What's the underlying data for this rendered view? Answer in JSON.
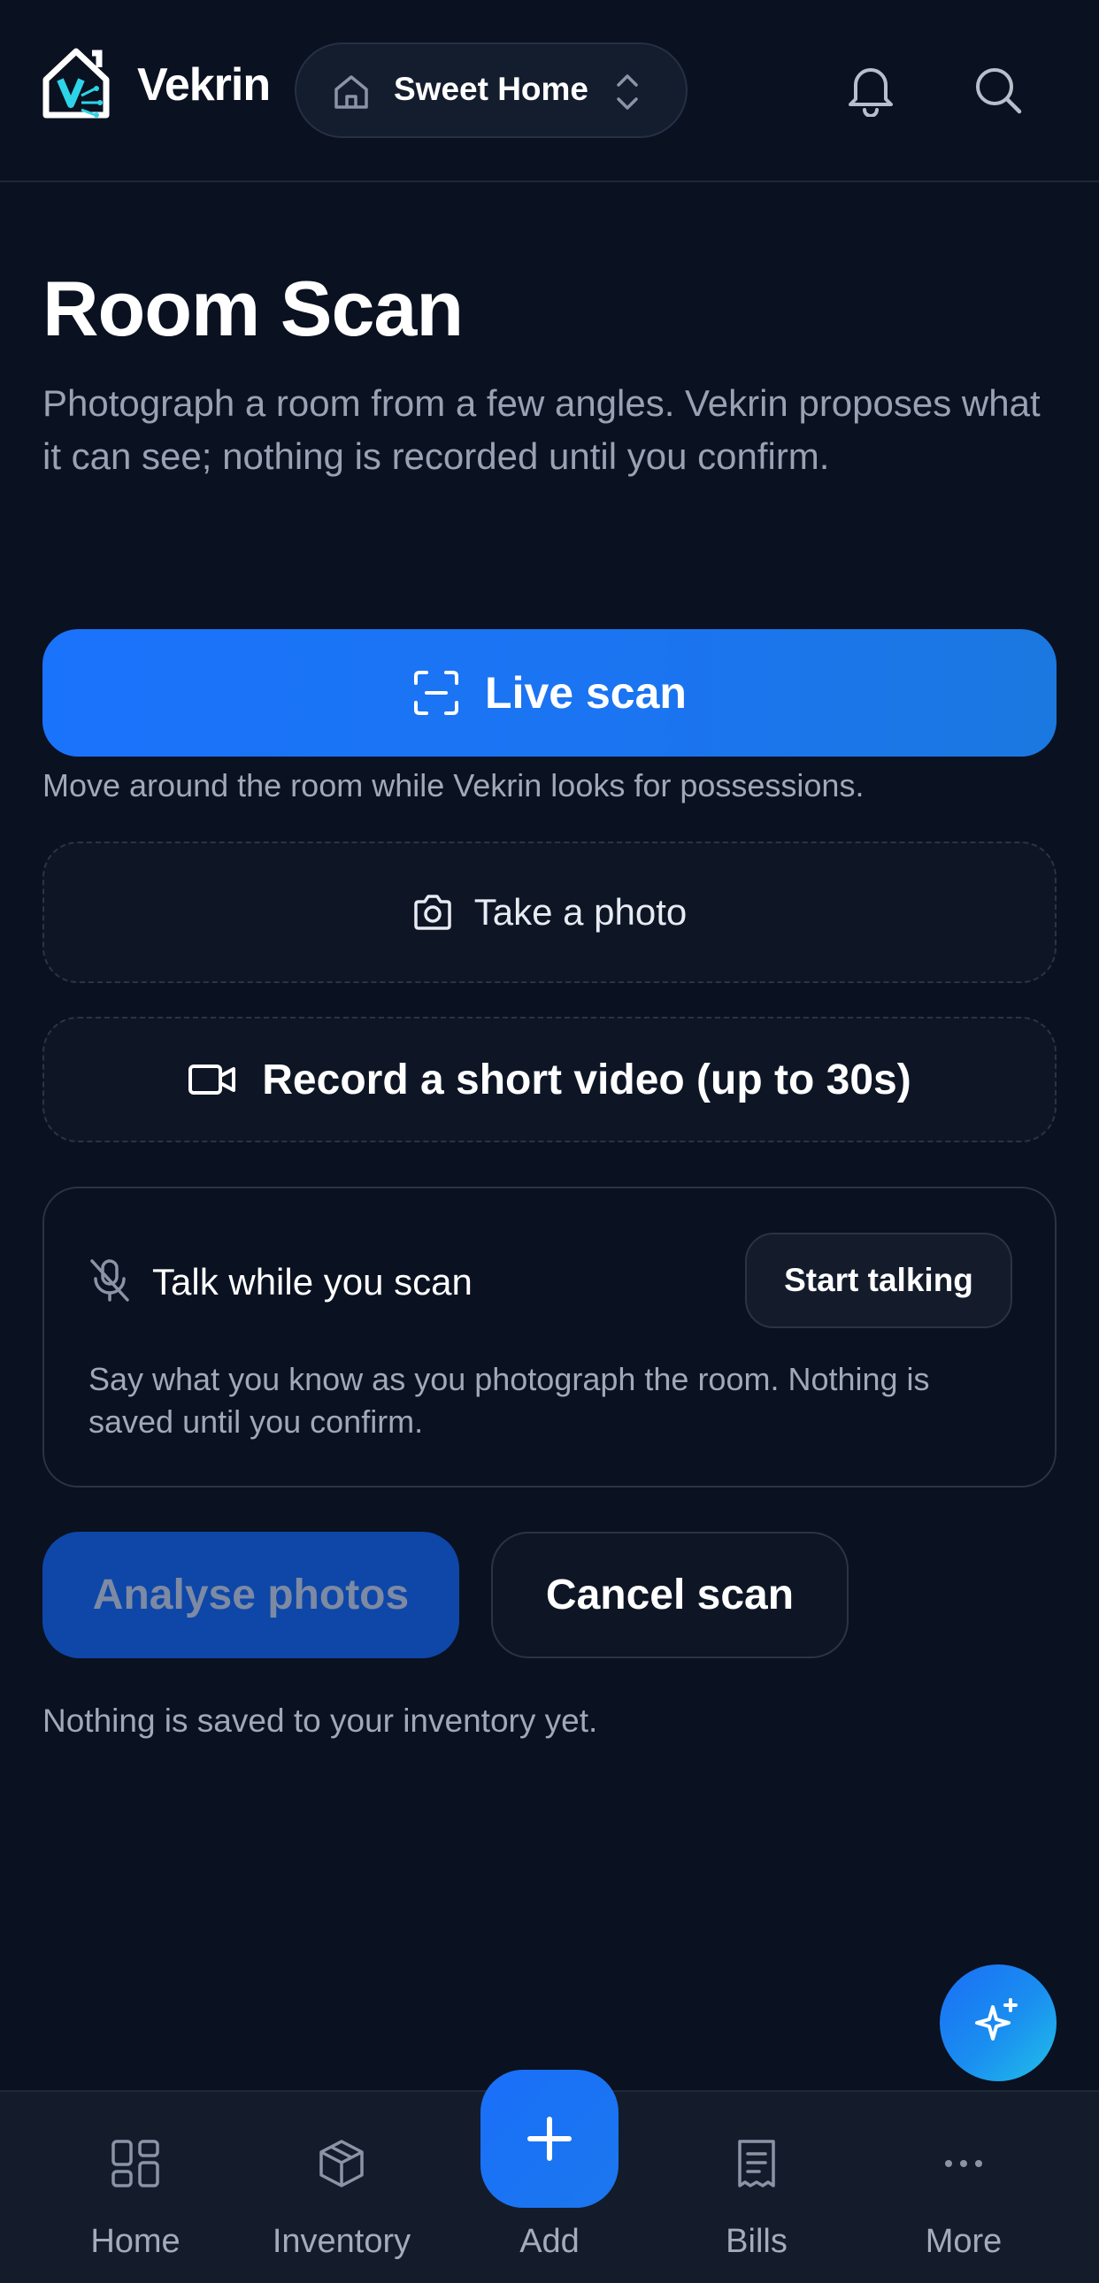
{
  "header": {
    "brand": "Vekrin",
    "home_selector": "Sweet Home"
  },
  "page": {
    "title": "Room Scan",
    "subtitle": "Photograph a room from a few angles. Vekrin proposes what it can see; nothing is recorded until you confirm."
  },
  "scan": {
    "live_label": "Live scan",
    "live_help": "Move around the room while Vekrin looks for possessions.",
    "photo_label": "Take a photo",
    "video_label": "Record a short video (up to 30s)"
  },
  "talk": {
    "title": "Talk while you scan",
    "start_label": "Start talking",
    "description": "Say what you know as you photograph the room. Nothing is saved until you confirm."
  },
  "actions": {
    "analyse_label": "Analyse photos",
    "cancel_label": "Cancel scan",
    "note": "Nothing is saved to your inventory yet."
  },
  "nav": {
    "home": "Home",
    "inventory": "Inventory",
    "add": "Add",
    "bills": "Bills",
    "more": "More"
  },
  "colors": {
    "background": "#0a1120",
    "accent": "#1a73fb",
    "logo_teal": "#2dd4e8"
  }
}
